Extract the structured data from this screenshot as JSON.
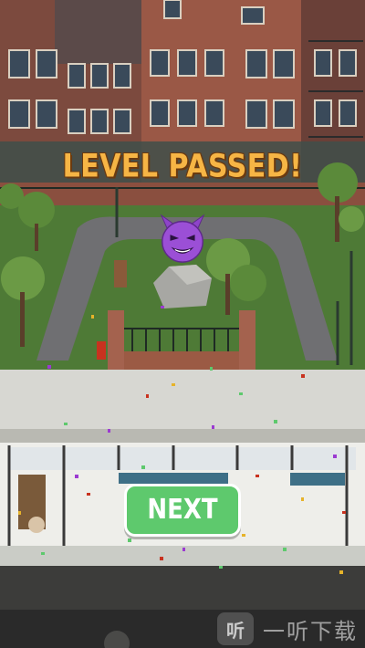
{
  "header": {
    "title": "LEVEL PASSED!"
  },
  "result": {
    "emoji": "smiling-face-with-horns-icon"
  },
  "actions": {
    "next_label": "NEXT"
  },
  "watermark": {
    "logo_text": "听",
    "text": "一听下载"
  },
  "colors": {
    "title": "#f6b545",
    "title_outline": "#6a3a10",
    "button": "#5ec96d",
    "button_border": "#ffffff",
    "emoji": "#8e44c9",
    "grass": "#4e7a36",
    "brick": "#9b5a44"
  }
}
